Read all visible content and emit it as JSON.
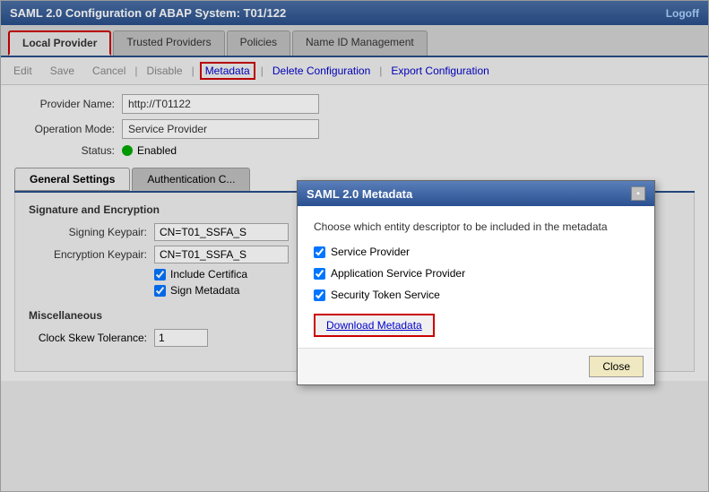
{
  "window": {
    "title": "SAML 2.0 Configuration of ABAP System: T01/122",
    "logoff": "Logoff"
  },
  "tabs": {
    "items": [
      {
        "label": "Local Provider",
        "active": true
      },
      {
        "label": "Trusted Providers",
        "active": false
      },
      {
        "label": "Policies",
        "active": false
      },
      {
        "label": "Name ID Management",
        "active": false
      }
    ]
  },
  "toolbar": {
    "edit": "Edit",
    "save": "Save",
    "cancel": "Cancel",
    "metadata": "Metadata",
    "delete": "Delete Configuration",
    "export": "Export Configuration"
  },
  "fields": {
    "provider_name_label": "Provider Name:",
    "provider_name_value": "http://T01122",
    "operation_mode_label": "Operation Mode:",
    "operation_mode_value": "Service Provider",
    "status_label": "Status:",
    "status_value": "Enabled"
  },
  "inner_tabs": {
    "items": [
      {
        "label": "General Settings",
        "active": true
      },
      {
        "label": "Authentication C...",
        "active": false
      }
    ]
  },
  "signature_section": {
    "title": "Signature and Encryption",
    "signing_keypair_label": "Signing Keypair:",
    "signing_keypair_value": "CN=T01_SSFA_S",
    "encryption_keypair_label": "Encryption Keypair:",
    "encryption_keypair_value": "CN=T01_SSFA_S",
    "include_cert_label": "Include Certifica",
    "sign_metadata_label": "Sign Metadata"
  },
  "misc_section": {
    "title": "Miscellaneous",
    "clock_skew_label": "Clock Skew Tolerance:",
    "clock_skew_value": "1"
  },
  "modal": {
    "title": "SAML 2.0 Metadata",
    "description": "Choose which entity descriptor to be included in the metadata",
    "options": [
      {
        "label": "Service Provider",
        "checked": true
      },
      {
        "label": "Application Service Provider",
        "checked": true
      },
      {
        "label": "Security Token Service",
        "checked": true
      }
    ],
    "download_button": "Download Metadata",
    "close_button": "Close"
  }
}
